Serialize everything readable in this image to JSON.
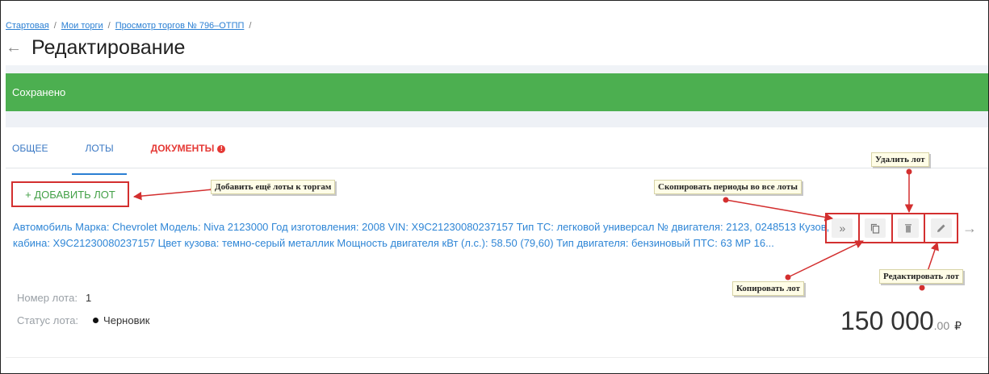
{
  "breadcrumb": {
    "items": [
      "Стартовая",
      "Мои торги",
      "Просмотр торгов № 796–ОТПП"
    ],
    "separator": "/"
  },
  "header": {
    "back_icon": "arrow-left-icon",
    "title": "Редактирование"
  },
  "alert": {
    "text": "Сохранено",
    "color": "#4caf50"
  },
  "tabs": [
    {
      "label": "ОБЩЕЕ",
      "active": false
    },
    {
      "label": "ЛОТЫ",
      "active": true
    },
    {
      "label": "ДОКУМЕНТЫ",
      "active": false,
      "has_warning": true
    }
  ],
  "add_lot": {
    "label": "+ ДОБАВИТЬ ЛОТ"
  },
  "lot": {
    "description": "Автомобиль Марка: Chevrolet Модель: Niva 2123000 Год изготовления: 2008 VIN: X9C21230080237157 Тип ТС: легковой универсал № двигателя: 2123, 0248513 Кузов, кабина: X9C21230080237157 Цвет кузова: темно-серый металлик Мощность двигателя кВт (л.с.): 58.50 (79,60) Тип двигателя: бензиновый ПТС: 63 МР 16...",
    "number_label": "Номер лота:",
    "number_value": "1",
    "status_label": "Статус лота:",
    "status_value": "Черновик",
    "price_main": "150 000",
    "price_cents": ".00",
    "currency": "₽"
  },
  "actions": {
    "copy_periods_icon": "double-chevron-right-icon",
    "copy_icon": "copy-icon",
    "delete_icon": "trash-icon",
    "edit_icon": "pencil-icon",
    "next_icon": "arrow-right-icon"
  },
  "callouts": {
    "add_more": "Добавить ещё лоты к торгам",
    "copy_periods": "Скопировать периоды во все лоты",
    "delete": "Удалить лот",
    "copy_lot": "Копировать лот",
    "edit": "Редактировать лот"
  },
  "annotation_color": "#d32f2f"
}
